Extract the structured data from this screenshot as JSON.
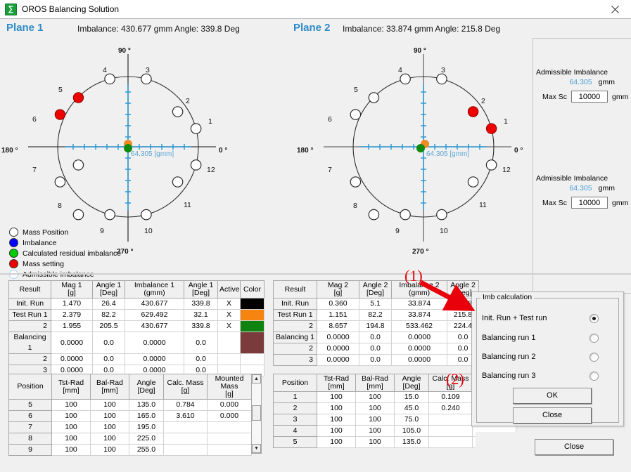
{
  "window": {
    "title": "OROS Balancing Solution",
    "app_icon": "oros-logo-icon",
    "close_icon": "×"
  },
  "plane1": {
    "title": "Plane 1",
    "subtitle": "Imbalance: 430.677 gmm Angle: 339.8 Deg",
    "axis_labels": {
      "top": "90 °",
      "right": "0 °",
      "bottom": "270 °",
      "left": "180 °"
    },
    "scale_label": "64.305 [gmm]"
  },
  "plane2": {
    "title": "Plane 2",
    "subtitle": "Imbalance: 33.874 gmm Angle: 215.8 Deg",
    "axis_labels": {
      "top": "90 °",
      "right": "0 °",
      "bottom": "270 °",
      "left": "180 °"
    },
    "scale_label": "64.305 [gmm]"
  },
  "chart_data": [
    {
      "type": "scatter",
      "title": "Plane 1 polar mass-position diagram",
      "coordinate": "polar",
      "angle_unit": "deg",
      "position_labels": [
        "1",
        "2",
        "3",
        "4",
        "5",
        "6",
        "7",
        "8",
        "9",
        "10",
        "11",
        "12"
      ],
      "position_angles": [
        15,
        45,
        75,
        105,
        135,
        165,
        195,
        225,
        255,
        285,
        315,
        345
      ],
      "mass_positions_empty": [
        1,
        2,
        3,
        4,
        7,
        8,
        9,
        10,
        11,
        12
      ],
      "mass_setting_filled": [
        5,
        6
      ],
      "imbalance_marker": {
        "r": 0,
        "angle": 339.8,
        "color": "#0000ff"
      },
      "residual_marker": {
        "r": 0,
        "angle": 0,
        "color": "#00a000"
      },
      "admissible_circle_radius_gmm": 64.305,
      "radial_scale_label": "64.305 [gmm]"
    },
    {
      "type": "scatter",
      "title": "Plane 2 polar mass-position diagram",
      "coordinate": "polar",
      "angle_unit": "deg",
      "position_labels": [
        "1",
        "2",
        "3",
        "4",
        "5",
        "6",
        "7",
        "8",
        "9",
        "10",
        "11",
        "12"
      ],
      "position_angles": [
        15,
        45,
        75,
        105,
        135,
        165,
        195,
        225,
        255,
        285,
        315,
        345
      ],
      "mass_positions_empty": [
        3,
        4,
        5,
        6,
        7,
        8,
        9,
        10,
        11,
        12
      ],
      "mass_setting_filled": [
        1,
        2
      ],
      "imbalance_marker": {
        "r": 0,
        "angle": 215.8,
        "color": "#0000ff"
      },
      "residual_marker": {
        "r": 0,
        "angle": 0,
        "color": "#00a000"
      },
      "admissible_circle_radius_gmm": 64.305,
      "radial_scale_label": "64.305 [gmm]"
    }
  ],
  "legend": {
    "items": [
      {
        "label": "Mass Position",
        "color": "#ffffff"
      },
      {
        "label": "Imbalance",
        "color": "#0000ff"
      },
      {
        "label": "Calculated residual imbalance",
        "color": "#00cc00"
      },
      {
        "label": "Mass setting",
        "color": "#ee0000"
      },
      {
        "label": "Admissible imbalance",
        "color": "#ffffff"
      }
    ]
  },
  "right_panel": {
    "blocks": [
      {
        "title": "Admissible Imbalance",
        "value": "64.305",
        "value_unit": "gmm",
        "maxsc_label": "Max Sc",
        "maxsc_value": "10000",
        "maxsc_unit": "gmm"
      },
      {
        "title": "Admissible Imbalance",
        "value": "64.305",
        "value_unit": "gmm",
        "maxsc_label": "Max Sc",
        "maxsc_value": "10000",
        "maxsc_unit": "gmm"
      }
    ]
  },
  "result_table_1": {
    "headers": [
      "Result",
      "Mag 1  [g]",
      "Angle 1\n[Deg]",
      "Imbalance 1\n(gmm)",
      "Angle 1\n[Deg]",
      "Active",
      "Color"
    ],
    "headers_flat": [
      "Result",
      "Mag 1  [g]",
      "Angle 1 [Deg]",
      "Imbalance 1 (gmm)",
      "Angle 1 [Deg]",
      "Active",
      "Color"
    ],
    "rows": [
      {
        "result": "Init. Run",
        "mag": "1.470",
        "angle1": "26.4",
        "imbalance": "430.677",
        "angle2": "339.8",
        "active": "X",
        "color": "#000000"
      },
      {
        "result": "Test Run 1",
        "mag": "2.379",
        "angle1": "82.2",
        "imbalance": "629.492",
        "angle2": "32.1",
        "active": "X",
        "color": "#f58410"
      },
      {
        "result": "2",
        "mag": "1.955",
        "angle1": "205.5",
        "imbalance": "430.677",
        "angle2": "339.8",
        "active": "X",
        "color": "#10820f"
      },
      {
        "result": "Balancing 1",
        "mag": "0.0000",
        "angle1": "0.0",
        "imbalance": "0.0000",
        "angle2": "0.0",
        "active": "",
        "color": "#7b3b3b"
      },
      {
        "result": "2",
        "mag": "0.0000",
        "angle1": "0.0",
        "imbalance": "0.0000",
        "angle2": "0.0",
        "active": "",
        "color": "#ffffff"
      },
      {
        "result": "3",
        "mag": "0.0000",
        "angle1": "0.0",
        "imbalance": "0.0000",
        "angle2": "0.0",
        "active": "",
        "color": "#ffffff"
      }
    ]
  },
  "result_table_2": {
    "headers_flat": [
      "Result",
      "Mag 2  [g]",
      "Angle 2 [Deg]",
      "Imbalance 2 (gmm)",
      "Angle 2 [Deg]"
    ],
    "rows": [
      {
        "result": "Init. Run",
        "mag": "0.360",
        "angle1": "5.1",
        "imbalance": "33.874",
        "angle2": "215.8"
      },
      {
        "result": "Test Run 1",
        "mag": "1.151",
        "angle1": "82.2",
        "imbalance": "33.874",
        "angle2": "215.8"
      },
      {
        "result": "2",
        "mag": "8.657",
        "angle1": "194.8",
        "imbalance": "533.462",
        "angle2": "224.4"
      },
      {
        "result": "Balancing 1",
        "mag": "0.0000",
        "angle1": "0.0",
        "imbalance": "0.0000",
        "angle2": "0.0"
      },
      {
        "result": "2",
        "mag": "0.0000",
        "angle1": "0.0",
        "imbalance": "0.0000",
        "angle2": "0.0"
      },
      {
        "result": "3",
        "mag": "0.0000",
        "angle1": "0.0",
        "imbalance": "0.0000",
        "angle2": "0.0"
      }
    ]
  },
  "position_table_1": {
    "headers_flat": [
      "Position",
      "Tst-Rad [mm]",
      "Bal-Rad [mm]",
      "Angle [Deg]",
      "Calc. Mass [g]",
      "Mounted Mass  [g]"
    ],
    "rows": [
      {
        "position": "5",
        "tst": "100",
        "bal": "100",
        "angle": "135.0",
        "calc": "0.784",
        "mounted": "0.000"
      },
      {
        "position": "6",
        "tst": "100",
        "bal": "100",
        "angle": "165.0",
        "calc": "3.610",
        "mounted": "0.000"
      },
      {
        "position": "7",
        "tst": "100",
        "bal": "100",
        "angle": "195.0",
        "calc": "",
        "mounted": ""
      },
      {
        "position": "8",
        "tst": "100",
        "bal": "100",
        "angle": "225.0",
        "calc": "",
        "mounted": ""
      },
      {
        "position": "9",
        "tst": "100",
        "bal": "100",
        "angle": "255.0",
        "calc": "",
        "mounted": ""
      }
    ]
  },
  "position_table_2": {
    "headers_flat": [
      "Position",
      "Tst-Rad [mm]",
      "Bal-Rad [mm]",
      "Angle [Deg]",
      "Calc. Mass [g]"
    ],
    "rows": [
      {
        "position": "1",
        "tst": "100",
        "bal": "100",
        "angle": "15.0",
        "calc": "0.109"
      },
      {
        "position": "2",
        "tst": "100",
        "bal": "100",
        "angle": "45.0",
        "calc": "0.240"
      },
      {
        "position": "3",
        "tst": "100",
        "bal": "100",
        "angle": "75.0",
        "calc": ""
      },
      {
        "position": "4",
        "tst": "100",
        "bal": "100",
        "angle": "105.0",
        "calc": ""
      },
      {
        "position": "5",
        "tst": "100",
        "bal": "100",
        "angle": "135.0",
        "calc": ""
      }
    ]
  },
  "imb_dialog": {
    "group_label": "Imb calculation",
    "options": [
      {
        "label": "Init. Run + Test run",
        "selected": true
      },
      {
        "label": "Balancing run 1",
        "selected": false
      },
      {
        "label": "Balancing run 2",
        "selected": false
      },
      {
        "label": "Balancing run 3",
        "selected": false
      }
    ],
    "ok_label": "OK",
    "close_label": "Close"
  },
  "bottom": {
    "close_label": "Close"
  },
  "annotations": [
    {
      "label": "(1)",
      "color": "#e8000b"
    },
    {
      "label": "(2)",
      "color": "#e8000b"
    }
  ]
}
